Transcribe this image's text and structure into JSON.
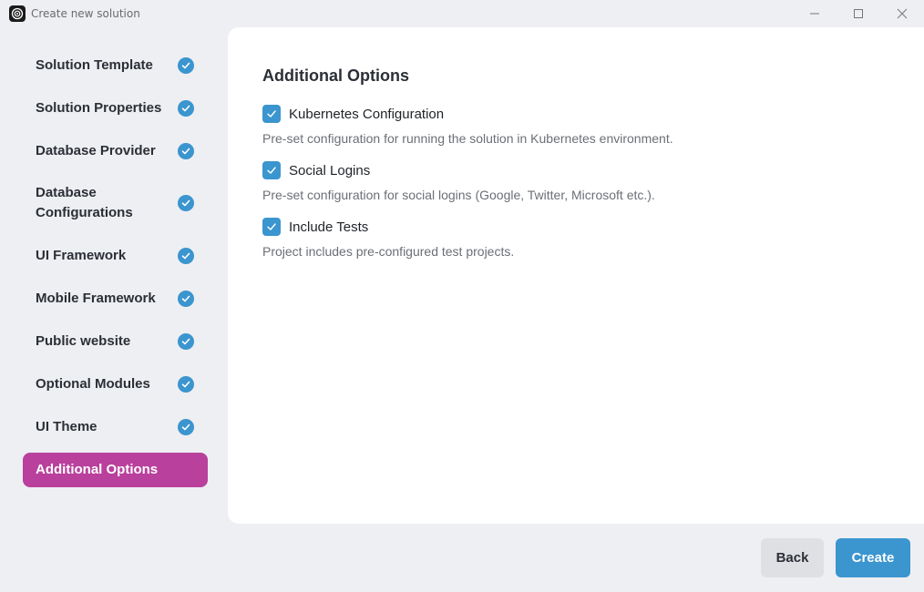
{
  "window": {
    "title": "Create new solution",
    "icon": "abp-logo-icon"
  },
  "sidebar": {
    "steps": [
      {
        "label": "Solution Template",
        "completed": true
      },
      {
        "label": "Solution Properties",
        "completed": true
      },
      {
        "label": "Database Provider",
        "completed": true
      },
      {
        "label": "Database Configurations",
        "completed": true
      },
      {
        "label": "UI Framework",
        "completed": true
      },
      {
        "label": "Mobile Framework",
        "completed": true
      },
      {
        "label": "Public website",
        "completed": true
      },
      {
        "label": "Optional Modules",
        "completed": true
      },
      {
        "label": "UI Theme",
        "completed": true
      },
      {
        "label": "Additional Options",
        "completed": false,
        "active": true
      }
    ]
  },
  "main": {
    "title": "Additional Options",
    "options": [
      {
        "label": "Kubernetes Configuration",
        "checked": true,
        "description": "Pre-set configuration for running the solution in Kubernetes environment."
      },
      {
        "label": "Social Logins",
        "checked": true,
        "description": "Pre-set configuration for social logins (Google, Twitter, Microsoft etc.)."
      },
      {
        "label": "Include Tests",
        "checked": true,
        "description": "Project includes pre-configured test projects."
      }
    ]
  },
  "footer": {
    "back_label": "Back",
    "create_label": "Create"
  },
  "colors": {
    "accent": "#3b95cf",
    "active_step": "#b9409c",
    "panel_bg": "#ffffff",
    "window_bg": "#eeeff2"
  }
}
